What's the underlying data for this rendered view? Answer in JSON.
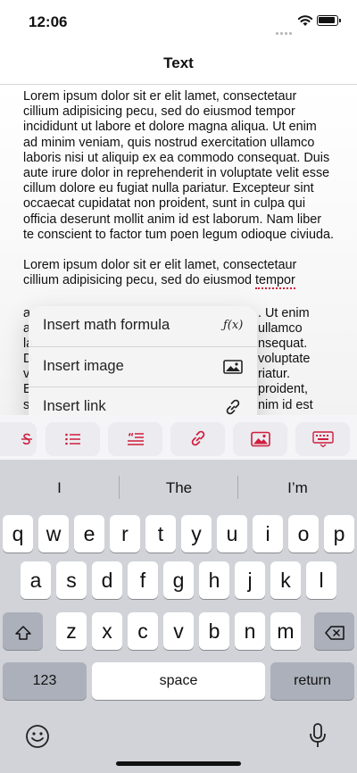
{
  "status": {
    "time": "12:06"
  },
  "nav": {
    "title": "Text"
  },
  "document": {
    "paragraphs": [
      "Lorem ipsum dolor sit er elit lamet, consectetaur cillium adipisicing pecu, sed do eiusmod tempor incididunt ut labore et dolore magna aliqua. Ut enim ad minim veniam, quis nostrud exercitation ullamco laboris nisi ut aliquip ex ea commodo consequat. Duis aute irure dolor in reprehenderit in voluptate velit esse cillum dolore eu fugiat nulla pariatur. Excepteur sint occaecat cupidatat non proident, sunt in culpa qui officia deserunt mollit anim id est laborum. Nam liber te conscient to factor tum poen legum odioque civiuda."
    ],
    "second_paragraph_visible": {
      "line1": "Lorem ipsum dolor sit er elit lamet, consectetaur",
      "line2_before": "cillium adipisicing pecu, sed do eiusmod ",
      "line2_typo": "tempor",
      "line3_right": ". Ut enim",
      "line4_right": "ullamco",
      "line5_right": "nsequat.",
      "line6_right": "voluptate",
      "line7_right": "riatur.",
      "line8_right": "proident,",
      "line9_right": "nim id est",
      "left_letters": [
        "a",
        "a",
        "la",
        "D",
        "v",
        "E",
        "s"
      ]
    }
  },
  "insert_menu": {
    "items": [
      {
        "label": "Insert math formula",
        "icon": "function-icon",
        "icon_text": "ƒ(x)"
      },
      {
        "label": "Insert image",
        "icon": "image-icon"
      },
      {
        "label": "Insert link",
        "icon": "link-icon"
      }
    ]
  },
  "toolbar": {
    "accent": "#d01c3c",
    "buttons": [
      "strikethrough-icon",
      "list-icon",
      "quote-icon",
      "link-icon",
      "image-icon",
      "keyboard-icon"
    ]
  },
  "keyboard": {
    "suggestions": [
      "I",
      "The",
      "I’m"
    ],
    "row1": [
      "q",
      "w",
      "e",
      "r",
      "t",
      "y",
      "u",
      "i",
      "o",
      "p"
    ],
    "row2": [
      "a",
      "s",
      "d",
      "f",
      "g",
      "h",
      "j",
      "k",
      "l"
    ],
    "row3": [
      "z",
      "x",
      "c",
      "v",
      "b",
      "n",
      "m"
    ],
    "numbers_key": "123",
    "space_key": "space",
    "return_key": "return"
  }
}
